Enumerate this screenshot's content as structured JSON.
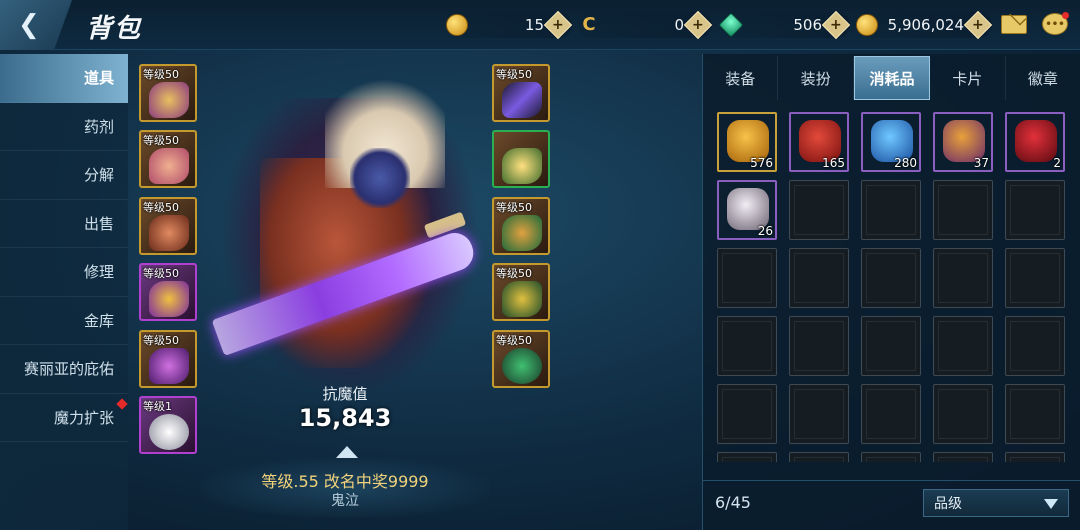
{
  "header": {
    "title": "背包",
    "currencies": [
      {
        "icon": "gold-coin-icon",
        "value": "15"
      },
      {
        "icon": "c-token-icon",
        "value": "0"
      },
      {
        "icon": "green-gem-icon",
        "value": "506"
      },
      {
        "icon": "gold-coin-icon",
        "value": "5,906,024"
      }
    ]
  },
  "sidebar": {
    "items": [
      {
        "label": "道具",
        "active": true
      },
      {
        "label": "药剂"
      },
      {
        "label": "分解"
      },
      {
        "label": "出售"
      },
      {
        "label": "修理"
      },
      {
        "label": "金库"
      },
      {
        "label": "赛丽亚的庇佑"
      },
      {
        "label": "魔力扩张",
        "badge": true
      }
    ]
  },
  "equipment": {
    "left": [
      {
        "level": "等级50"
      },
      {
        "level": "等级50"
      },
      {
        "level": "等级50"
      },
      {
        "level": "等级50"
      },
      {
        "level": "等级50"
      },
      {
        "level": "等级1"
      }
    ],
    "right": [
      {
        "level": "等级50"
      },
      {
        "level": ""
      },
      {
        "level": "等级50"
      },
      {
        "level": "等级50"
      },
      {
        "level": "等级50"
      }
    ]
  },
  "character": {
    "stat_label": "抗魔值",
    "stat_value": "15,843",
    "name": "等级.55 改名中奖9999",
    "class": "鬼泣"
  },
  "inventory": {
    "tabs": [
      "装备",
      "装扮",
      "消耗品",
      "卡片",
      "徽章"
    ],
    "active_tab": 2,
    "items": [
      {
        "count": "576",
        "icon": "gold-orb-icon",
        "colors": [
          "#f7c34a",
          "#a35f08"
        ]
      },
      {
        "count": "165",
        "icon": "red-bell-icon",
        "colors": [
          "#e24a3a",
          "#7a1010"
        ]
      },
      {
        "count": "280",
        "icon": "blue-crystal-icon",
        "colors": [
          "#6fc8ff",
          "#1a4fa0"
        ]
      },
      {
        "count": "37",
        "icon": "cupcake-icon",
        "colors": [
          "#e8a13a",
          "#6a2a6a"
        ]
      },
      {
        "count": "2",
        "icon": "rose-icon",
        "colors": [
          "#e2303a",
          "#5a0a10"
        ]
      },
      {
        "count": "26",
        "icon": "white-stone-icon",
        "colors": [
          "#f2eef4",
          "#6a6070"
        ]
      }
    ],
    "capacity_text": "6/45",
    "grade_select": "品级"
  }
}
